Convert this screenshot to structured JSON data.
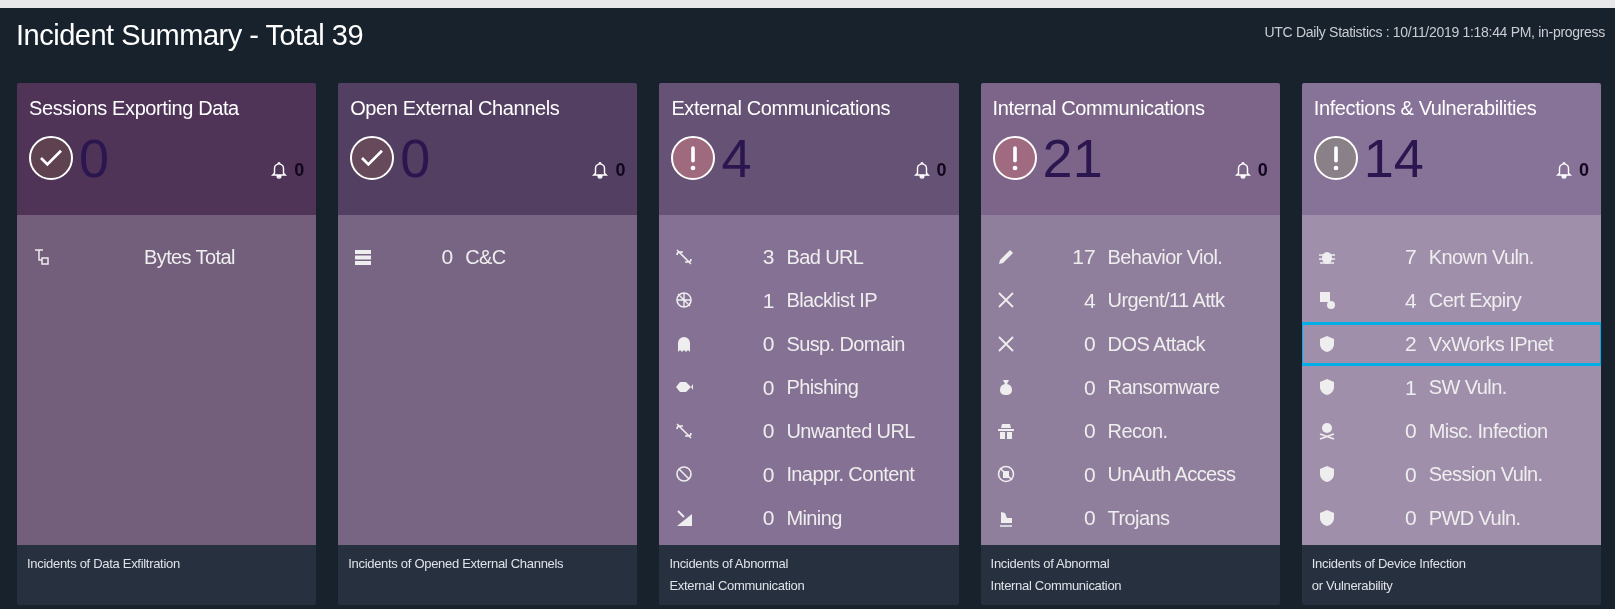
{
  "title": "Incident Summary - Total 39",
  "stats": "UTC Daily Statistics : 10/11/2019 1:18:44 PM, in-progress",
  "cards": [
    {
      "title": "Sessions Exporting Data",
      "alert": false,
      "count": "0",
      "bell_count": "0",
      "footer": "Incidents of Data Exfiltration",
      "rows": [
        {
          "count": "",
          "label": "Bytes Total",
          "selected": false
        }
      ]
    },
    {
      "title": "Open External Channels",
      "alert": false,
      "count": "0",
      "bell_count": "0",
      "footer": "Incidents of Opened External Channels",
      "rows": [
        {
          "count": "0",
          "label": "C&C",
          "selected": false
        }
      ]
    },
    {
      "title": "External Communications",
      "alert": true,
      "count": "4",
      "bell_count": "0",
      "footer": "Incidents of Abnormal\nExternal Communication",
      "rows": [
        {
          "count": "3",
          "label": "Bad URL",
          "selected": false
        },
        {
          "count": "1",
          "label": "Blacklist IP",
          "selected": false
        },
        {
          "count": "0",
          "label": "Susp. Domain",
          "selected": false
        },
        {
          "count": "0",
          "label": "Phishing",
          "selected": false
        },
        {
          "count": "0",
          "label": "Unwanted URL",
          "selected": false
        },
        {
          "count": "0",
          "label": "Inappr. Content",
          "selected": false
        },
        {
          "count": "0",
          "label": "Mining",
          "selected": false
        }
      ]
    },
    {
      "title": "Internal Communications",
      "alert": true,
      "count": "21",
      "bell_count": "0",
      "footer": "Incidents of Abnormal\nInternal Communication",
      "rows": [
        {
          "count": "17",
          "label": "Behavior Viol.",
          "selected": false
        },
        {
          "count": "4",
          "label": "Urgent/11 Attk",
          "selected": false
        },
        {
          "count": "0",
          "label": "DOS Attack",
          "selected": false
        },
        {
          "count": "0",
          "label": "Ransomware",
          "selected": false
        },
        {
          "count": "0",
          "label": "Recon.",
          "selected": false
        },
        {
          "count": "0",
          "label": "UnAuth Access",
          "selected": false
        },
        {
          "count": "0",
          "label": "Trojans",
          "selected": false
        }
      ]
    },
    {
      "title": "Infections & Vulnerabilities",
      "alert": true,
      "count": "14",
      "bell_count": "0",
      "footer": "Incidents of Device Infection\nor Vulnerability",
      "rows": [
        {
          "count": "7",
          "label": "Known Vuln.",
          "selected": false
        },
        {
          "count": "4",
          "label": "Cert Expiry",
          "selected": false
        },
        {
          "count": "2",
          "label": "VxWorks IPnet",
          "selected": true
        },
        {
          "count": "1",
          "label": "SW Vuln.",
          "selected": false
        },
        {
          "count": "0",
          "label": "Misc. Infection",
          "selected": false
        },
        {
          "count": "0",
          "label": "Session Vuln.",
          "selected": false
        },
        {
          "count": "0",
          "label": "PWD Vuln.",
          "selected": false
        }
      ]
    }
  ]
}
